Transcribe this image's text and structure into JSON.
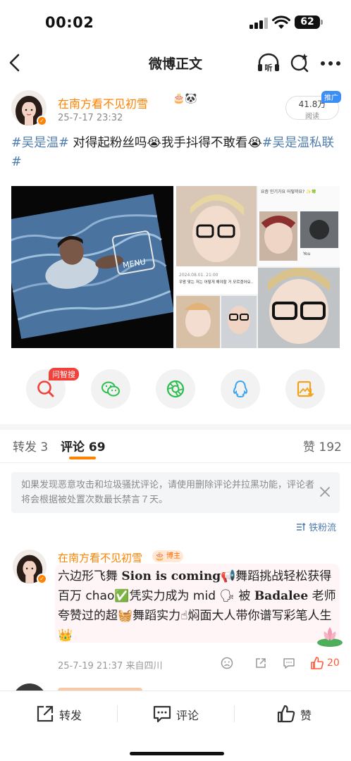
{
  "status_bar": {
    "time": "00:02",
    "battery": "62"
  },
  "nav": {
    "title": "微博正文",
    "icons": [
      "back-icon",
      "listen-icon",
      "refresh-icon",
      "more-icon"
    ],
    "listen_icon_text": "听"
  },
  "post": {
    "author": "在南方看不见初雪",
    "badges": "🎂🐼",
    "time": "25-7-17 23:32",
    "read_count": "41.8万",
    "read_label": "阅读",
    "promo_tag": "推广",
    "text_parts": {
      "topic1": "#吴是温#",
      "body1": " 对得起粉丝吗",
      "emoji": "😭",
      "body2": "我手抖得不敢看",
      "topic2": "#吴是温私联#"
    },
    "image_overlay_text": "MENU",
    "image_right_captions": {
      "c1": "요즘 인기가요 어떻까요? ✨🍀",
      "c2": "2024.08.01. 21:00",
      "c3": "우왕 맞는 저는 어떻게 해야할 거 모르겠어요..",
      "c4": "You"
    }
  },
  "actions": {
    "ai_tag": "问智搜",
    "items": [
      "ai-search-icon",
      "wechat-icon",
      "moments-icon",
      "qq-icon",
      "save-image-icon"
    ]
  },
  "tabs": {
    "repost_label": "转发",
    "repost_count": "3",
    "comment_label": "评论",
    "comment_count": "69",
    "like_label": "赞",
    "like_count": "192"
  },
  "notice": {
    "text": "如果发现恶意攻击和垃圾骚扰评论，请使用删除评论并拉黑功能，评论者将会根据被处置次数最长禁言７天。"
  },
  "sort": {
    "label": "铁粉流"
  },
  "comment": {
    "author": "在南方看不见初雪",
    "badge": "博主",
    "t1": "六边形飞舞 ",
    "b1": "Sion is coming",
    "t2": "舞蹈挑战轻松获得百万 chao",
    "t3": "凭实力成为 mid ",
    "t4": " 被 ",
    "b2": "Badalee",
    "t5": " 老师夸赞过的超",
    "t6": "舞蹈实力",
    "t7": "焖面大人带你谱写彩笔人生",
    "e_speaker": "📢",
    "e_check": "✅",
    "e_talk": "🗣",
    "e_basket": "🧺",
    "e_hand": "☝",
    "e_crown": "👑",
    "time": "25-7-19 21:37",
    "location": "来自四川",
    "likes": "20"
  },
  "bottom_bar": {
    "repost": "转发",
    "comment": "评论",
    "like": "赞"
  },
  "colors": {
    "accent": "#ff8200",
    "link": "#507daf",
    "like_red": "#ff5b3a"
  }
}
